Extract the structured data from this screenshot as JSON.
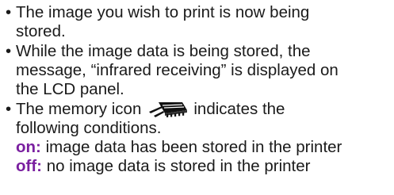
{
  "bullet_glyph": "•",
  "items": [
    {
      "lines": [
        "The image you wish to print is now being",
        "stored."
      ]
    },
    {
      "lines": [
        "While the image data is being stored, the",
        "message, “infrared receiving” is displayed on",
        "the LCD panel."
      ]
    },
    {
      "line1_before": "The memory icon",
      "line1_after": "indicates the",
      "line2": "following conditions.",
      "icon": "memory-card-icon",
      "states": [
        {
          "keyword": "on:",
          "text": " image data has been stored in the printer"
        },
        {
          "keyword": "off:",
          "text": " no image data is stored in the printer"
        }
      ]
    }
  ],
  "colors": {
    "keyword": "#7a1fa0",
    "text": "#1a1a1a"
  }
}
